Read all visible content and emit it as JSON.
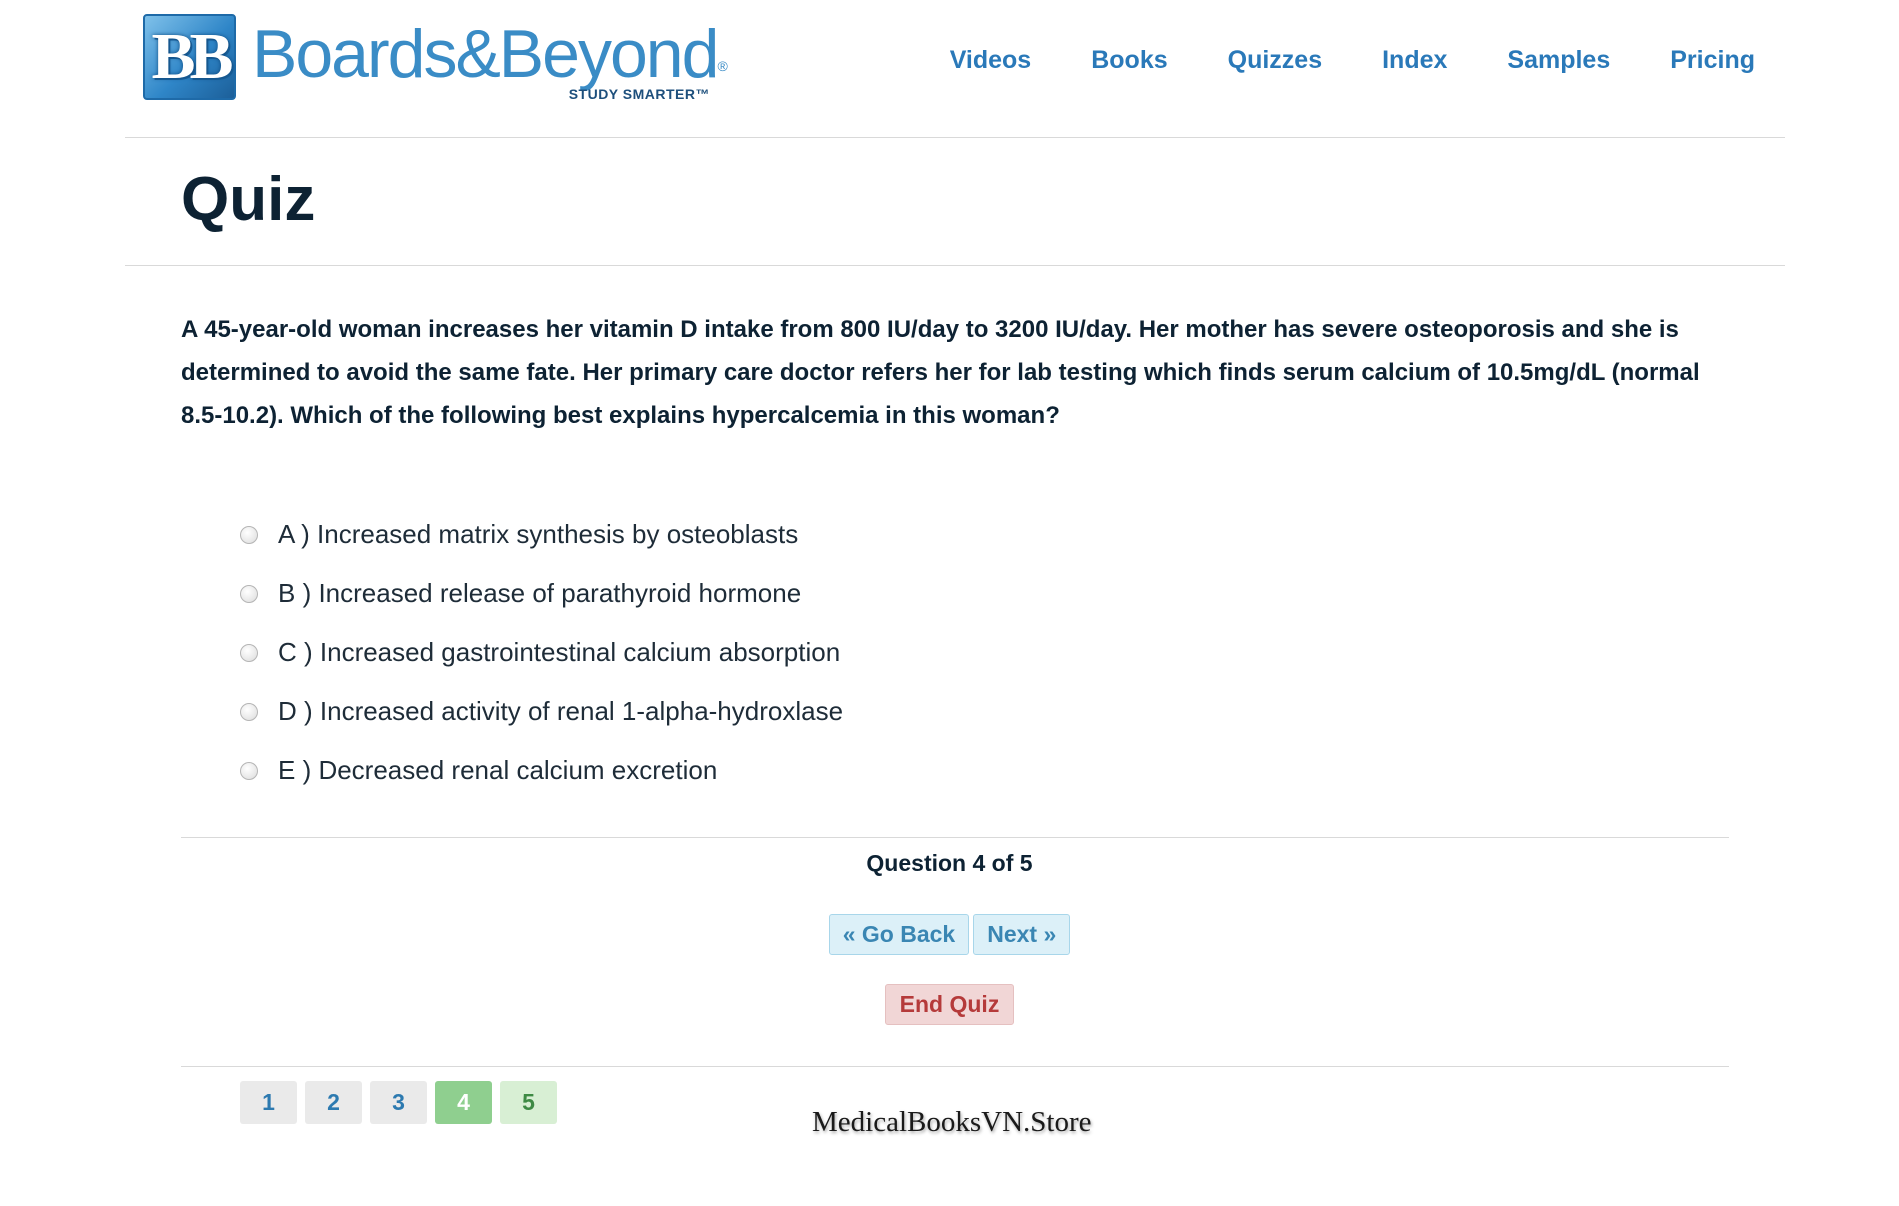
{
  "brand": {
    "badge": "BB",
    "name": "Boards&Beyond",
    "registered": "®",
    "tagline": "STUDY SMARTER™"
  },
  "nav": {
    "items": [
      {
        "label": "Videos"
      },
      {
        "label": "Books"
      },
      {
        "label": "Quizzes"
      },
      {
        "label": "Index"
      },
      {
        "label": "Samples"
      },
      {
        "label": "Pricing"
      }
    ]
  },
  "page": {
    "title": "Quiz"
  },
  "quiz": {
    "question": "A 45-year-old woman increases her vitamin D intake from 800 IU/day to 3200 IU/day. Her mother has severe osteoporosis and she is determined to avoid the same fate. Her primary care doctor refers her for lab testing which finds serum calcium of 10.5mg/dL (normal 8.5-10.2). Which of the following best explains hypercalcemia in this woman?",
    "choices": [
      {
        "label": "A ) Increased matrix synthesis by osteoblasts"
      },
      {
        "label": "B ) Increased release of parathyroid hormone"
      },
      {
        "label": "C ) Increased gastrointestinal calcium absorption"
      },
      {
        "label": "D ) Increased activity of renal 1-alpha-hydroxlase"
      },
      {
        "label": "E ) Decreased renal calcium excretion"
      }
    ],
    "status": "Question 4 of 5",
    "back_label": "« Go Back",
    "next_label": "Next »",
    "end_label": "End Quiz",
    "pages": [
      "1",
      "2",
      "3",
      "4",
      "5"
    ],
    "current_page": "4"
  },
  "watermark": "MedicalBooksVN.Store",
  "colors": {
    "brand_blue": "#3a8cc6",
    "nav_blue": "#2a79b9",
    "title_navy": "#0d2233",
    "end_red": "#b53a3a",
    "current_green": "#8fcf8f"
  }
}
